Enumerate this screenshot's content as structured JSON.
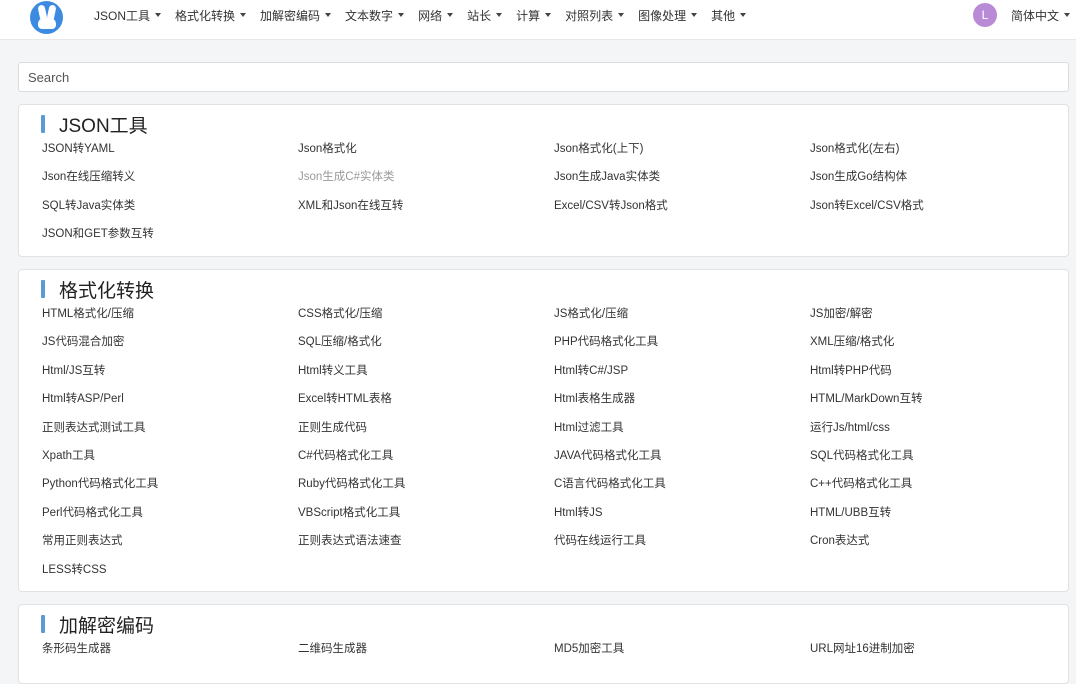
{
  "nav": {
    "items": [
      "JSON工具",
      "格式化转换",
      "加解密编码",
      "文本数字",
      "网络",
      "站长",
      "计算",
      "对照列表",
      "图像处理",
      "其他"
    ],
    "avatar_letter": "L",
    "language": "简体中文"
  },
  "search": {
    "placeholder": "Search"
  },
  "colors": {
    "accent_bar": "#5b9bd5",
    "logo": "#3d8be0",
    "avatar": "#b98ad6"
  },
  "sections": [
    {
      "title": "JSON工具",
      "tools": [
        "JSON转YAML",
        "Json格式化",
        "Json格式化(上下)",
        "Json格式化(左右)",
        "Json在线压缩转义",
        "Json生成C#实体类",
        "Json生成Java实体类",
        "Json生成Go结构体",
        "SQL转Java实体类",
        "XML和Json在线互转",
        "Excel/CSV转Json格式",
        "Json转Excel/CSV格式",
        "JSON和GET参数互转"
      ],
      "muted_index": 5
    },
    {
      "title": "格式化转换",
      "tools": [
        "HTML格式化/压缩",
        "CSS格式化/压缩",
        "JS格式化/压缩",
        "JS加密/解密",
        "JS代码混合加密",
        "SQL压缩/格式化",
        "PHP代码格式化工具",
        "XML压缩/格式化",
        "Html/JS互转",
        "Html转义工具",
        "Html转C#/JSP",
        "Html转PHP代码",
        "Html转ASP/Perl",
        "Excel转HTML表格",
        "Html表格生成器",
        "HTML/MarkDown互转",
        "正则表达式测试工具",
        "正则生成代码",
        "Html过滤工具",
        "运行Js/html/css",
        "Xpath工具",
        "C#代码格式化工具",
        "JAVA代码格式化工具",
        "SQL代码格式化工具",
        "Python代码格式化工具",
        "Ruby代码格式化工具",
        "C语言代码格式化工具",
        "C++代码格式化工具",
        "Perl代码格式化工具",
        "VBScript格式化工具",
        "Html转JS",
        "HTML/UBB互转",
        "常用正则表达式",
        "正则表达式语法速查",
        "代码在线运行工具",
        "Cron表达式",
        "LESS转CSS"
      ]
    },
    {
      "title": "加解密编码",
      "tools": [
        "条形码生成器",
        "二维码生成器",
        "MD5加密工具",
        "URL网址16进制加密"
      ]
    }
  ]
}
